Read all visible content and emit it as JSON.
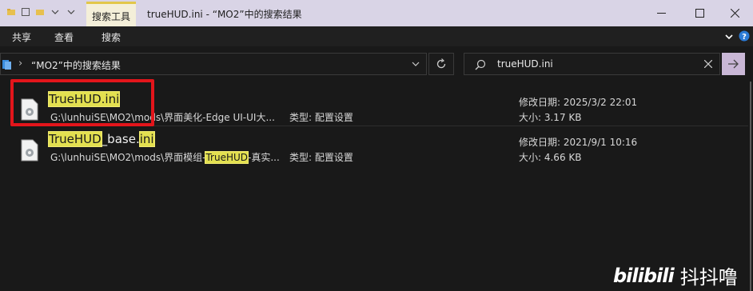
{
  "titlebar": {
    "context_tab": "搜索工具",
    "title": "trueHUD.ini - “MO2”中的搜索结果"
  },
  "ribbon": {
    "tabs": [
      "共享",
      "查看",
      "搜索"
    ]
  },
  "address": {
    "separator": "›",
    "path": "“MO2”中的搜索结果"
  },
  "search": {
    "value": "trueHUD.ini"
  },
  "results": [
    {
      "name_parts": [
        {
          "t": "TrueHUD.ini",
          "hl": true
        }
      ],
      "path_parts": [
        {
          "t": "G:\\lunhuiSE\\MO2\\mods\\界面美化-Edge UI-UI大...",
          "hl": false
        }
      ],
      "type_label": "类型: ",
      "type_value": "配置设置",
      "modified_label": "修改日期: ",
      "modified_value": "2025/3/2 22:01",
      "size_label": "大小: ",
      "size_value": "3.17 KB"
    },
    {
      "name_parts": [
        {
          "t": "TrueHUD",
          "hl": true
        },
        {
          "t": "_base",
          "hl": false
        },
        {
          "t": ".",
          "hl": false
        },
        {
          "t": "ini",
          "hl": true
        }
      ],
      "path_parts": [
        {
          "t": "G:\\lunhuiSE\\MO2\\mods\\界面模组-",
          "hl": false
        },
        {
          "t": "TrueHUD",
          "hl": true
        },
        {
          "t": "-真实...",
          "hl": false
        }
      ],
      "type_label": "类型: ",
      "type_value": "配置设置",
      "modified_label": "修改日期: ",
      "modified_value": "2021/9/1 10:16",
      "size_label": "大小: ",
      "size_value": "4.66 KB"
    }
  ],
  "watermark": {
    "logo": "bilibili",
    "author": "抖抖噜"
  },
  "colors": {
    "titlebar_bg": "#d9d4e6",
    "highlight": "#e3e050",
    "annotation_box": "#e3151b",
    "go_button": "#c9b7d6"
  }
}
